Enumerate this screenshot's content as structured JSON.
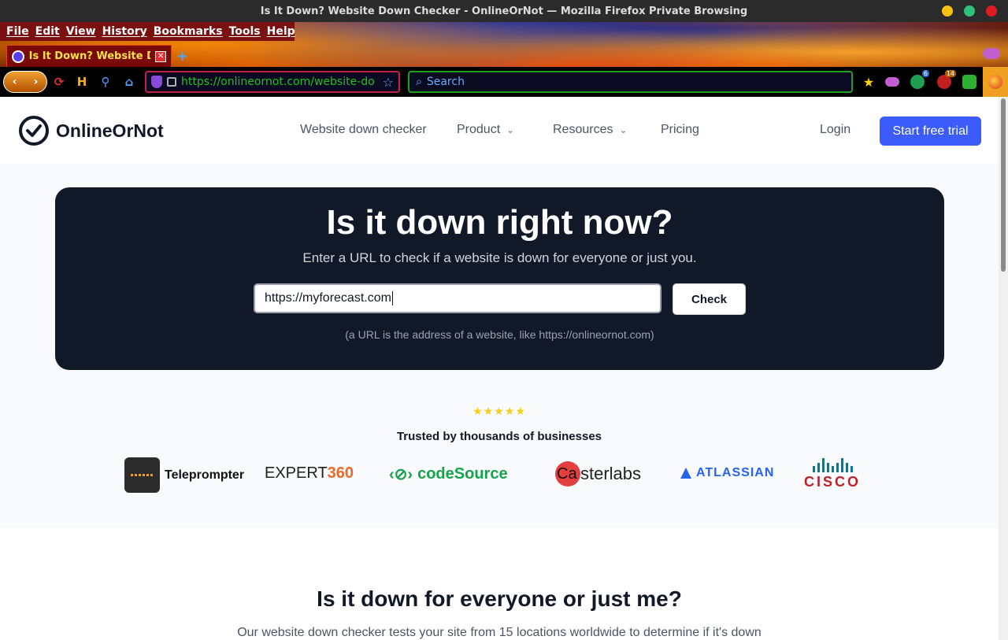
{
  "window": {
    "title": "Is It Down? Website Down Checker - OnlineOrNot — Mozilla Firefox Private Browsing",
    "controls": {
      "minimize_color": "#f5c211",
      "maximize_color": "#2ec27e",
      "close_color": "#e01b24"
    }
  },
  "menubar": {
    "items": [
      {
        "label": "File"
      },
      {
        "label": "Edit"
      },
      {
        "label": "View"
      },
      {
        "label": "History"
      },
      {
        "label": "Bookmarks"
      },
      {
        "label": "Tools"
      },
      {
        "label": "Help"
      }
    ]
  },
  "tabs": [
    {
      "title": "Is It Down? Website Down",
      "close": "✕"
    }
  ],
  "new_tab": "+",
  "toolbar": {
    "back": "‹",
    "forward": "›",
    "url": "https://onlineornot.com/website-do",
    "search_placeholder": "Search",
    "search_glyph": "⌕",
    "bookmark_star": "☆",
    "ext_badge_1": "6",
    "ext_badge_2": "14"
  },
  "site": {
    "brand": "OnlineOrNot",
    "nav": [
      {
        "label": "Website down checker",
        "has_menu": false
      },
      {
        "label": "Product",
        "has_menu": true
      },
      {
        "label": "Resources",
        "has_menu": true
      },
      {
        "label": "Pricing",
        "has_menu": false
      }
    ],
    "login": "Login",
    "cta": "Start free trial",
    "accent": "#3b5bfa"
  },
  "hero": {
    "title": "Is it down right now?",
    "subtitle": "Enter a URL to check if a website is down for everyone or just you.",
    "input_value": "https://myforecast.com",
    "button": "Check",
    "hint": "(a URL is the address of a website, like https://onlineornot.com)"
  },
  "social_proof": {
    "stars": "★★★★★",
    "rating": 5,
    "tagline": "Trusted by thousands of businesses",
    "brands": [
      {
        "name": "Teleprompter"
      },
      {
        "name": "EXPERT",
        "suffix": "360"
      },
      {
        "name": "codeSource"
      },
      {
        "name": "Ca",
        "rest": "sterlabs"
      },
      {
        "name": "ATLASSIAN"
      },
      {
        "name": "CISCO"
      }
    ]
  },
  "section2": {
    "title": "Is it down for everyone or just me?",
    "subtitle": "Our website down checker tests your site from 15 locations worldwide to determine if it's down"
  }
}
